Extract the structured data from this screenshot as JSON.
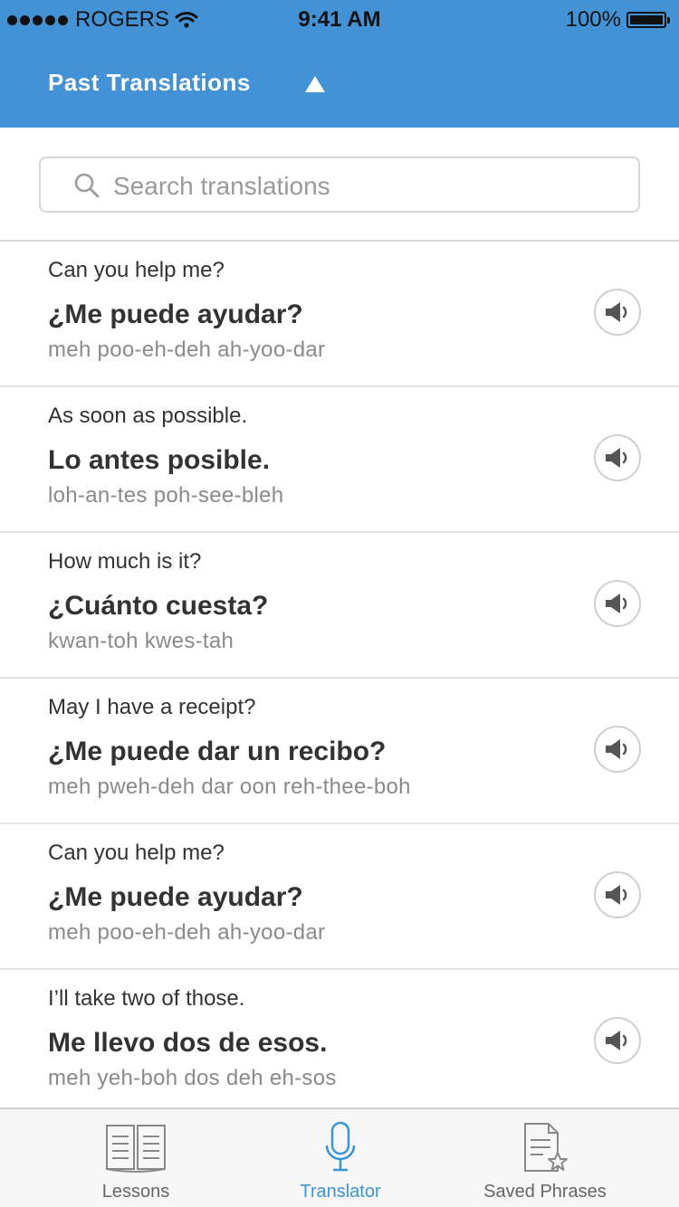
{
  "status_bar": {
    "carrier": "ROGERS",
    "time": "9:41 AM",
    "battery": "100%"
  },
  "header": {
    "title": "Past Translations",
    "toggle_icon": "triangle-up-icon",
    "background_color": "#4392d5"
  },
  "search": {
    "placeholder": "Search translations",
    "value": "",
    "icon": "search-icon"
  },
  "translations": [
    {
      "english": "Can you help me?",
      "spanish": "¿Me puede ayudar?",
      "pronunciation": "meh poo-eh-deh ah-yoo-dar"
    },
    {
      "english": "As soon as possible.",
      "spanish": "Lo antes posible.",
      "pronunciation": "loh-an-tes poh-see-bleh"
    },
    {
      "english": "How much is it?",
      "spanish": "¿Cuánto cuesta?",
      "pronunciation": "kwan-toh kwes-tah"
    },
    {
      "english": "May I have a receipt?",
      "spanish": "¿Me puede dar un recibo?",
      "pronunciation": "meh pweh-deh dar oon reh-thee-boh"
    },
    {
      "english": "Can you help me?",
      "spanish": "¿Me puede ayudar?",
      "pronunciation": "meh poo-eh-deh ah-yoo-dar"
    },
    {
      "english": "I’ll take two of those.",
      "spanish": "Me llevo dos de esos.",
      "pronunciation": "meh yeh-boh dos deh eh-sos"
    }
  ],
  "tabs": [
    {
      "label": "Lessons",
      "icon": "book-icon",
      "active": false
    },
    {
      "label": "Translator",
      "icon": "microphone-icon",
      "active": true
    },
    {
      "label": "Saved Phrases",
      "icon": "saved-document-icon",
      "active": false
    }
  ],
  "colors": {
    "accent": "#3b94d6",
    "secondary_text": "#8a8a8a"
  }
}
